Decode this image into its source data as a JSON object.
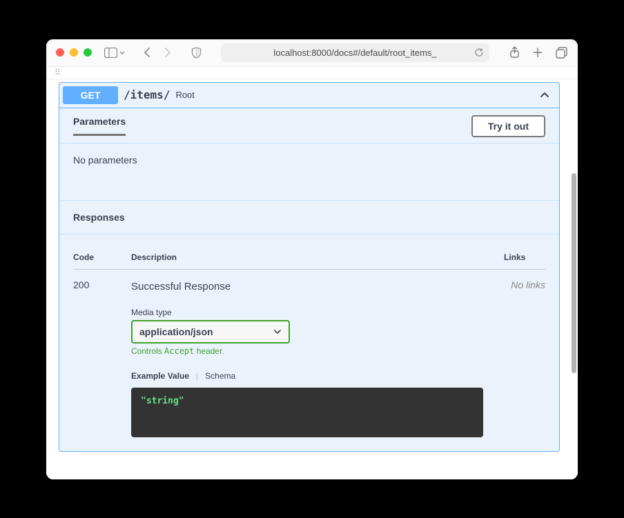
{
  "browser": {
    "url": "localhost:8000/docs#/default/root_items_"
  },
  "operation": {
    "method": "GET",
    "path": "/items/",
    "summary": "Root"
  },
  "sections": {
    "parameters_tab": "Parameters",
    "try_it_out": "Try it out",
    "no_parameters": "No parameters",
    "responses_header": "Responses"
  },
  "response_table": {
    "code_header": "Code",
    "description_header": "Description",
    "links_header": "Links"
  },
  "response": {
    "code": "200",
    "description": "Successful Response",
    "links": "No links",
    "media_type_label": "Media type",
    "media_type_value": "application/json",
    "accept_hint_prefix": "Controls ",
    "accept_hint_code": "Accept",
    "accept_hint_suffix": " header.",
    "example_tab": "Example Value",
    "schema_tab": "Schema",
    "example_body": "\"string\""
  }
}
